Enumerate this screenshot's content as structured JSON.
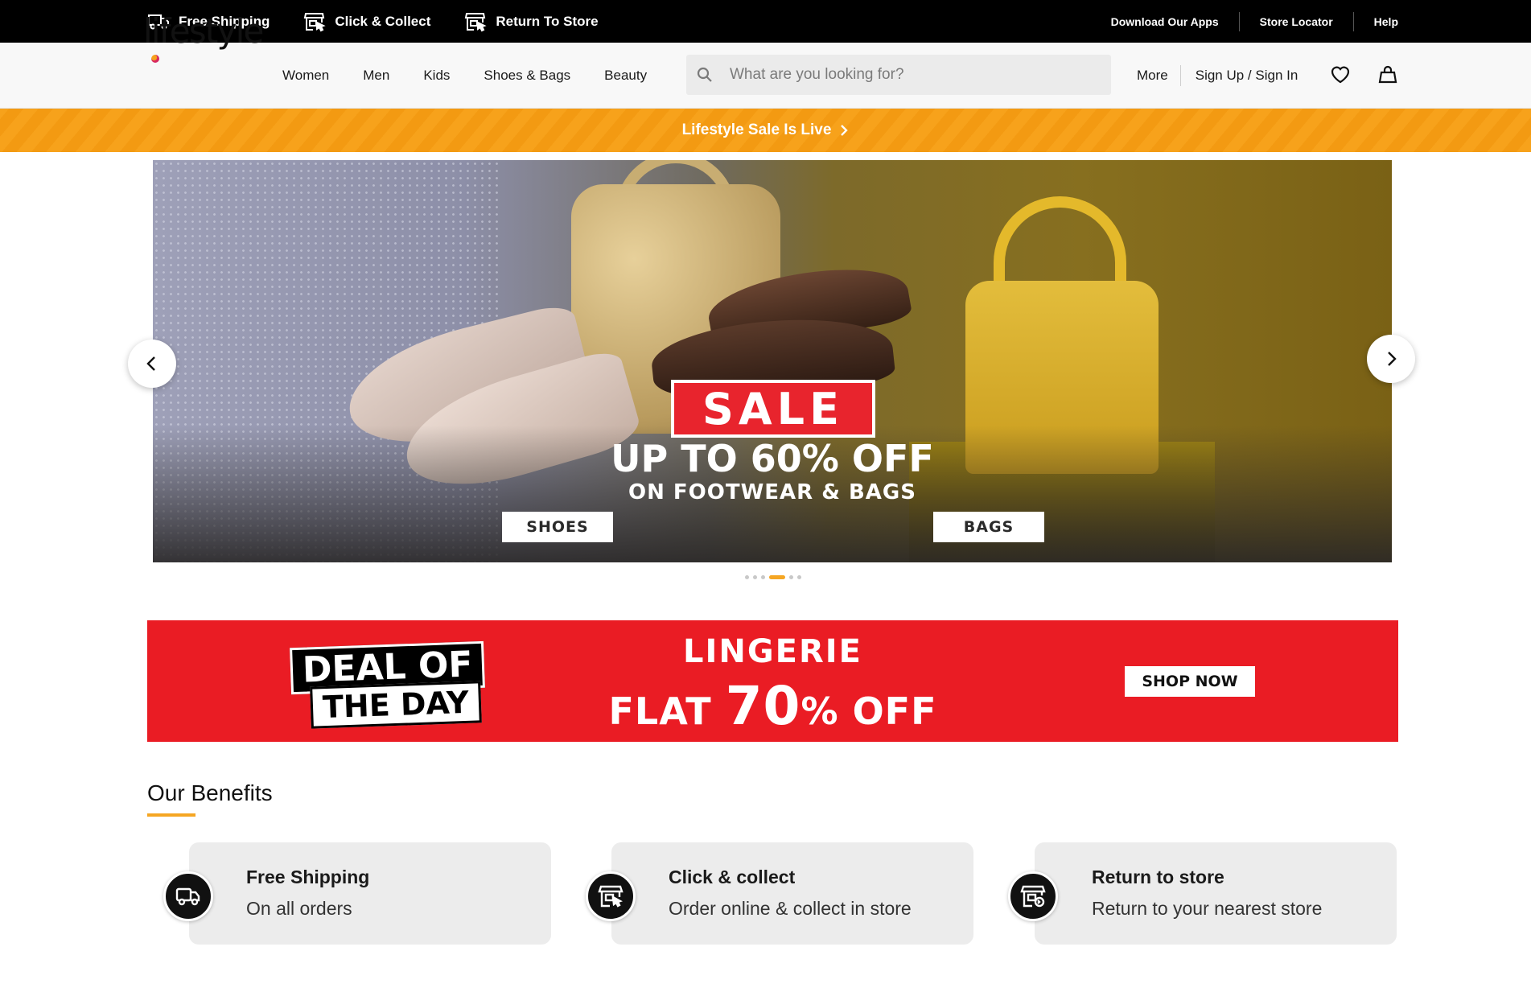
{
  "topbar": {
    "items": [
      {
        "label": "Free Shipping",
        "icon": "truck-icon"
      },
      {
        "label": "Click & Collect",
        "icon": "store-click-icon"
      },
      {
        "label": "Return To Store",
        "icon": "store-return-icon"
      }
    ],
    "links": [
      "Download Our Apps",
      "Store Locator",
      "Help"
    ]
  },
  "header": {
    "logo": "lifestyle",
    "nav": [
      "Women",
      "Men",
      "Kids",
      "Shoes & Bags",
      "Beauty"
    ],
    "search_placeholder": "What are you looking for?",
    "more": "More",
    "sign": "Sign Up / Sign In"
  },
  "sale_strip": {
    "label": "Lifestyle Sale Is Live"
  },
  "hero": {
    "sale": "SALE",
    "headline": "UP TO 60% OFF",
    "subline": "ON FOOTWEAR & BAGS",
    "cta_left": "SHOES",
    "cta_right": "BAGS",
    "slide_count": 6,
    "active_slide": 4
  },
  "deal": {
    "line1": "DEAL OF",
    "line2": "THE DAY",
    "title": "LINGERIE",
    "offer_pre": "FLAT ",
    "offer_big": "70",
    "offer_post": "% OFF",
    "cta": "SHOP NOW"
  },
  "benefits": {
    "title": "Our Benefits",
    "cards": [
      {
        "title": "Free Shipping",
        "subtitle": "On all orders",
        "icon": "truck-icon"
      },
      {
        "title": "Click & collect",
        "subtitle": "Order online & collect in store",
        "icon": "store-click-icon"
      },
      {
        "title": "Return to store",
        "subtitle": "Return to your nearest store",
        "icon": "store-return-icon"
      }
    ]
  },
  "colors": {
    "accent": "#f5a623",
    "deal_red": "#ea1c24",
    "topbar": "#000000"
  }
}
